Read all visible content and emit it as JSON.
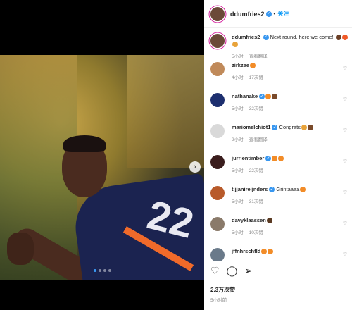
{
  "post": {
    "username": "ddumfries2",
    "follow_label": "关注",
    "jersey_number": "22",
    "caption": {
      "text": "Next round, here we come!",
      "time": "5小时",
      "translate": "查看翻译"
    },
    "likes": "2.3万次赞",
    "time_ago": "5小时前"
  },
  "comments": [
    {
      "user": "zirkzee",
      "verified": false,
      "text": "",
      "time": "4小时",
      "likes": "17次赞",
      "reply": "",
      "emoji": [
        "#f28c28"
      ]
    },
    {
      "user": "nathanake",
      "verified": true,
      "text": "",
      "time": "5小时",
      "likes": "32次赞",
      "reply": "",
      "emoji": [
        "#f28c28",
        "#7a4a2a"
      ]
    },
    {
      "user": "mariomelchiot1",
      "verified": true,
      "text": "Congrats",
      "time": "2小时",
      "likes": "",
      "reply": "查看翻译",
      "emoji": [
        "#e8a33a",
        "#7a4a2a"
      ]
    },
    {
      "user": "jurrientimber",
      "verified": true,
      "text": "",
      "time": "5小时",
      "likes": "22次赞",
      "reply": "",
      "emoji": [
        "#f28c28",
        "#f28c28"
      ]
    },
    {
      "user": "tijjanireijnders",
      "verified": true,
      "text": "Grintaaaa",
      "time": "5小时",
      "likes": "31次赞",
      "reply": "",
      "emoji": [
        "#f28c28"
      ]
    },
    {
      "user": "davyklaassen",
      "verified": false,
      "text": "",
      "time": "5小时",
      "likes": "10次赞",
      "reply": "",
      "emoji": [
        "#5a3a22"
      ]
    },
    {
      "user": "jffnhrschfld",
      "verified": false,
      "text": "",
      "time": "",
      "likes": "",
      "reply": "",
      "emoji": [
        "#f28c28",
        "#f28c28"
      ]
    }
  ],
  "icons": {
    "like": "heart-icon",
    "comment": "comment-icon",
    "share": "share-icon",
    "next": "chevron-right-icon"
  },
  "colors": {
    "accent": "#0095f6",
    "verified": "#3897f0"
  }
}
